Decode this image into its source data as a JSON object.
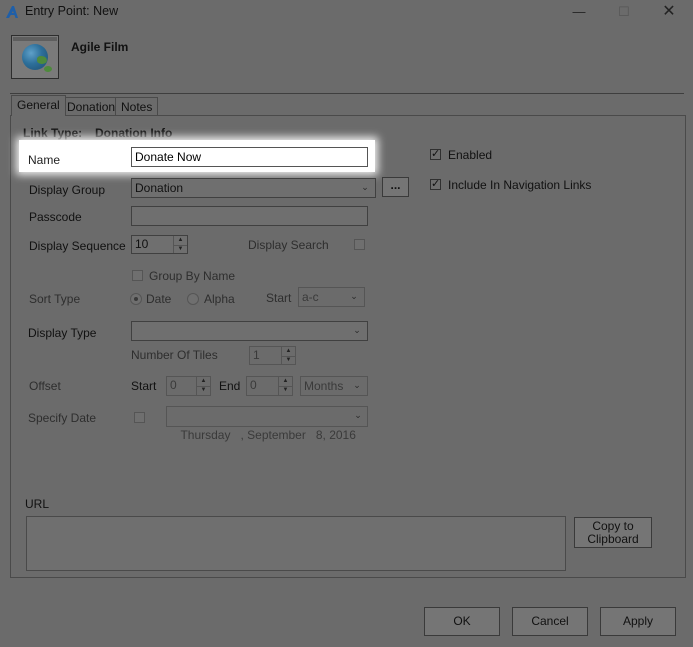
{
  "window": {
    "title": "Entry Point: New",
    "min_glyph": "—",
    "max_glyph": "☐",
    "close_glyph": "✕"
  },
  "header": {
    "title": "Agile Film"
  },
  "tabs": [
    {
      "label": "General",
      "active": true
    },
    {
      "label": "Donation",
      "active": false
    },
    {
      "label": "Notes",
      "active": false
    }
  ],
  "general": {
    "link_type_label": "Link Type:",
    "link_type_value": "Donation Info",
    "name_label": "Name",
    "name_value": "Donate Now",
    "display_group_label": "Display Group",
    "display_group_value": "Donation",
    "browse_button": "...",
    "passcode_label": "Passcode",
    "passcode_value": "",
    "display_sequence_label": "Display Sequence",
    "display_sequence_value": "10",
    "display_search_label": "Display Search",
    "group_by_name_label": "Group By Name",
    "sort_type_label": "Sort Type",
    "sort_date_label": "Date",
    "sort_alpha_label": "Alpha",
    "start_label": "Start",
    "start_value": "a-c",
    "display_type_label": "Display Type",
    "display_type_value": "",
    "number_of_tiles_label": "Number Of Tiles",
    "number_of_tiles_value": "1",
    "offset_label": "Offset",
    "offset_start_label": "Start",
    "offset_start_value": "0",
    "offset_end_label": "End",
    "offset_end_value": "0",
    "offset_unit_value": "Months",
    "specify_date_label": "Specify Date",
    "date_value": "Thursday   , September   8, 2016",
    "enabled_label": "Enabled",
    "include_nav_label": "Include In Navigation Links",
    "url_label": "URL",
    "url_value": "",
    "copy_button": "Copy to Clipboard"
  },
  "footer": {
    "ok": "OK",
    "cancel": "Cancel",
    "apply": "Apply"
  },
  "icons": {
    "check": "✓",
    "chevron": "⌄",
    "spin_up": "▲",
    "spin_down": "▼"
  }
}
